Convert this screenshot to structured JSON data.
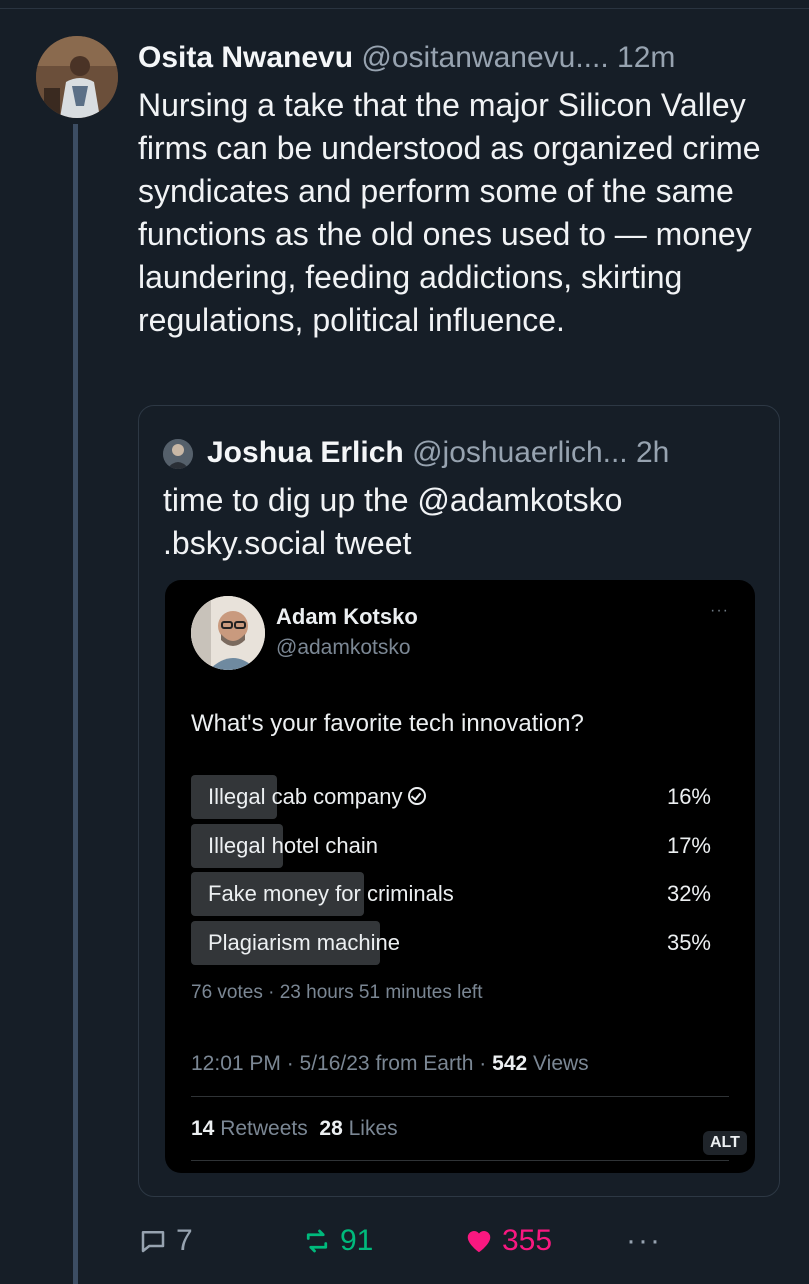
{
  "post": {
    "author_name": "Osita Nwanevu",
    "author_handle": "@ositanwanevu....",
    "time": "12m",
    "text": "Nursing a take that the major Silicon Valley firms can be understood as organized crime syndicates and perform some of the same functions as the old ones used to — money laundering, feeding addictions, skirting regulations, political influence."
  },
  "quote": {
    "author_name": "Joshua Erlich",
    "author_handle": "@joshuaerlich...",
    "time": "2h",
    "text_line1": "time to dig up the @adamkotsko",
    "text_line2": ".bsky.social tweet"
  },
  "embedded_tweet": {
    "author_name": "Adam Kotsko",
    "author_handle": "@adamkotsko",
    "more": "···",
    "question": "What's your favorite tech innovation?",
    "poll_options": [
      {
        "label": "Illegal cab company",
        "percent_text": "16%",
        "percent": 16,
        "verified_icon": "check-circle-icon"
      },
      {
        "label": "Illegal hotel chain",
        "percent_text": "17%",
        "percent": 17
      },
      {
        "label": "Fake money for criminals",
        "percent_text": "32%",
        "percent": 32
      },
      {
        "label": "Plagiarism machine",
        "percent_text": "35%",
        "percent": 35
      }
    ],
    "poll_meta": "76 votes · 23 hours 51 minutes left",
    "timestamp": "12:01 PM · 5/16/23 from Earth · ",
    "views_count": "542",
    "views_label": " Views",
    "retweets_count": "14",
    "retweets_label": " Retweets",
    "likes_count": "28",
    "likes_label": " Likes",
    "alt_badge": "ALT"
  },
  "actions": {
    "reply_count": "7",
    "repost_count": "91",
    "like_count": "355",
    "more": "···",
    "colors": {
      "reply": "#97a3b0",
      "repost": "#00ba7c",
      "like": "#f91880"
    }
  }
}
